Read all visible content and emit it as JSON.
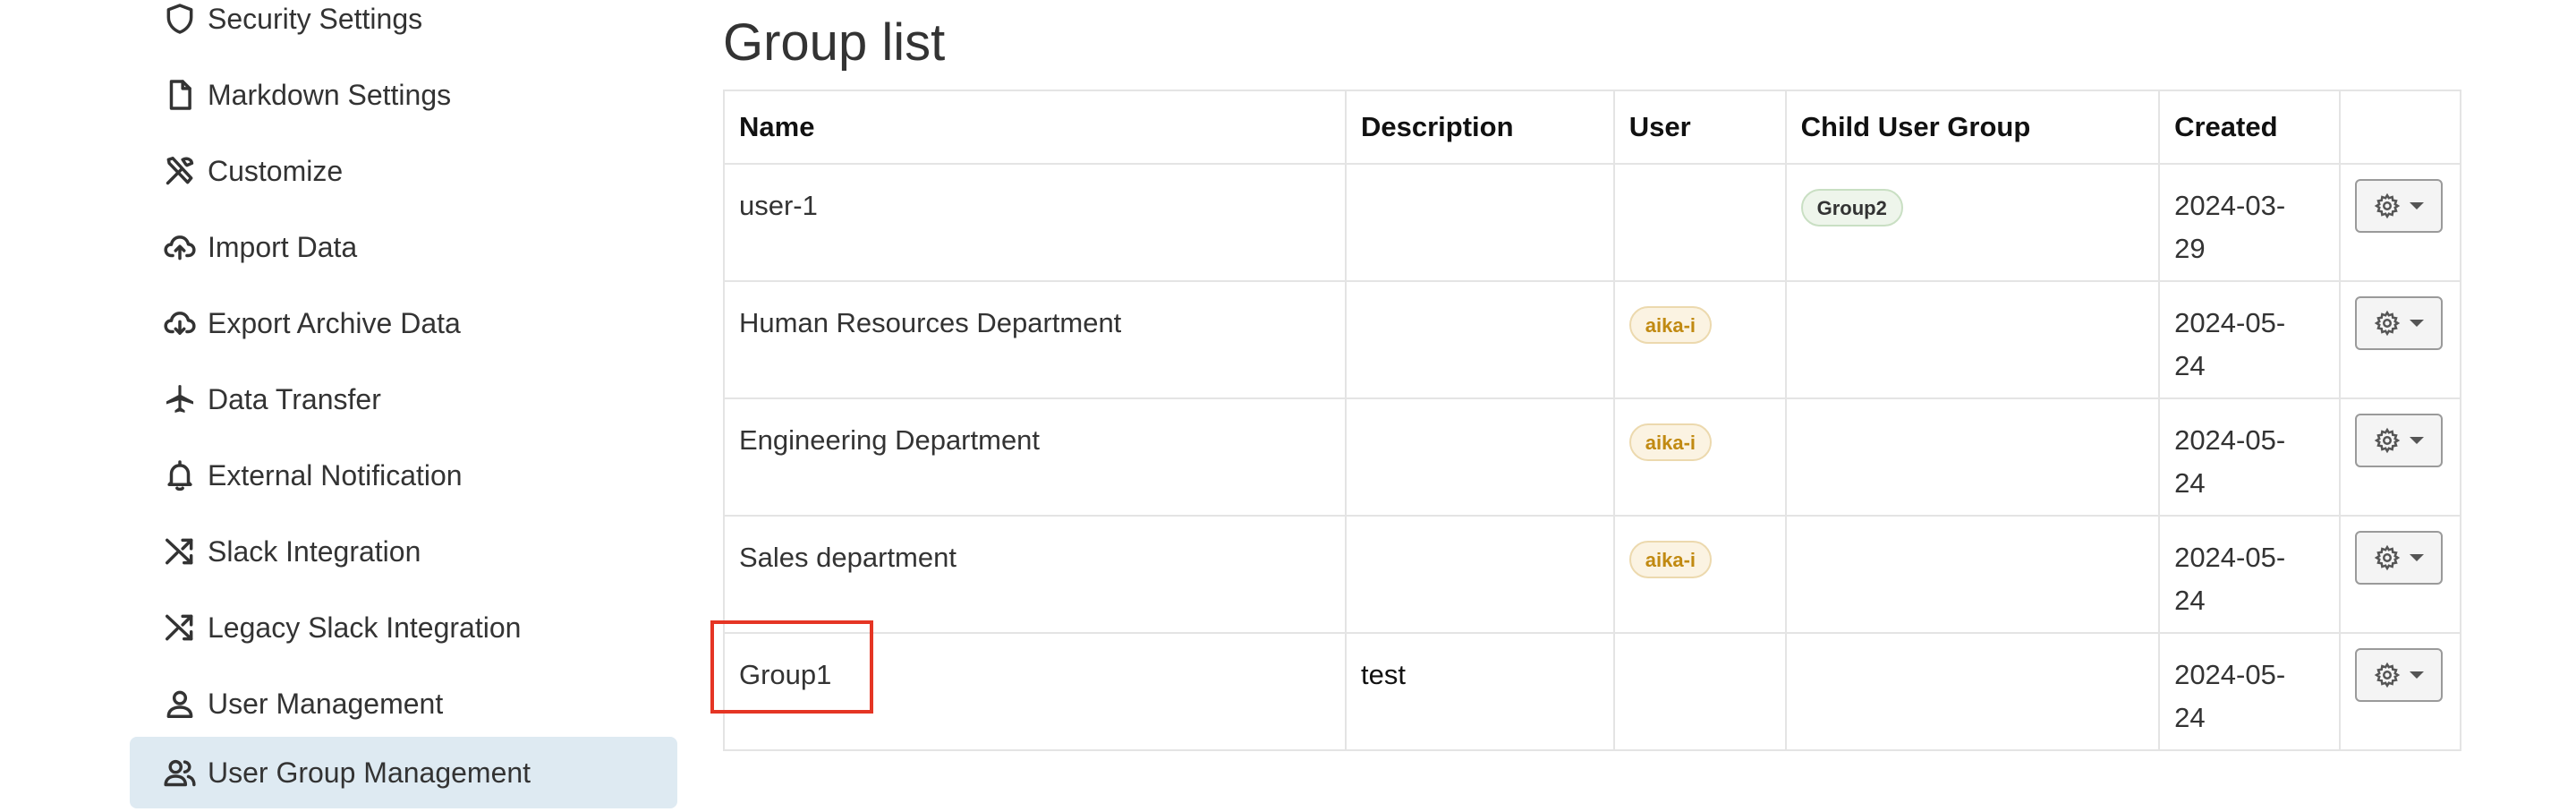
{
  "sidebar": {
    "items": [
      {
        "label": "Security Settings",
        "icon": "shield-icon"
      },
      {
        "label": "Markdown Settings",
        "icon": "file-icon"
      },
      {
        "label": "Customize",
        "icon": "tools-icon"
      },
      {
        "label": "Import Data",
        "icon": "cloud-upload-icon"
      },
      {
        "label": "Export Archive Data",
        "icon": "cloud-download-icon"
      },
      {
        "label": "Data Transfer",
        "icon": "airplane-icon"
      },
      {
        "label": "External Notification",
        "icon": "bell-icon"
      },
      {
        "label": "Slack Integration",
        "icon": "shuffle-icon"
      },
      {
        "label": "Legacy Slack Integration",
        "icon": "shuffle-icon"
      },
      {
        "label": "User Management",
        "icon": "person-icon"
      },
      {
        "label": "User Group Management",
        "icon": "people-icon",
        "active": true
      }
    ]
  },
  "main": {
    "title": "Group list",
    "table": {
      "headers": [
        "Name",
        "Description",
        "User",
        "Child User Group",
        "Created",
        ""
      ],
      "rows": [
        {
          "name": "user-1",
          "description": "",
          "user": "",
          "child_group": "Group2",
          "created_1": "2024-03-",
          "created_2": "29"
        },
        {
          "name": "Human Resources Department",
          "description": "",
          "user": "aika-i",
          "child_group": "",
          "created_1": "2024-05-",
          "created_2": "24"
        },
        {
          "name": "Engineering Department",
          "description": "",
          "user": "aika-i",
          "child_group": "",
          "created_1": "2024-05-",
          "created_2": "24"
        },
        {
          "name": "Sales department",
          "description": "",
          "user": "aika-i",
          "child_group": "",
          "created_1": "2024-05-",
          "created_2": "24"
        },
        {
          "name": "Group1",
          "description": "test",
          "user": "",
          "child_group": "",
          "created_1": "2024-05-",
          "created_2": "24"
        }
      ]
    }
  },
  "colors": {
    "active_bg": "#deeaf2",
    "highlight": "#e53524",
    "badge_user_text": "#c18a12",
    "badge_group_bg": "#eef5eb"
  }
}
